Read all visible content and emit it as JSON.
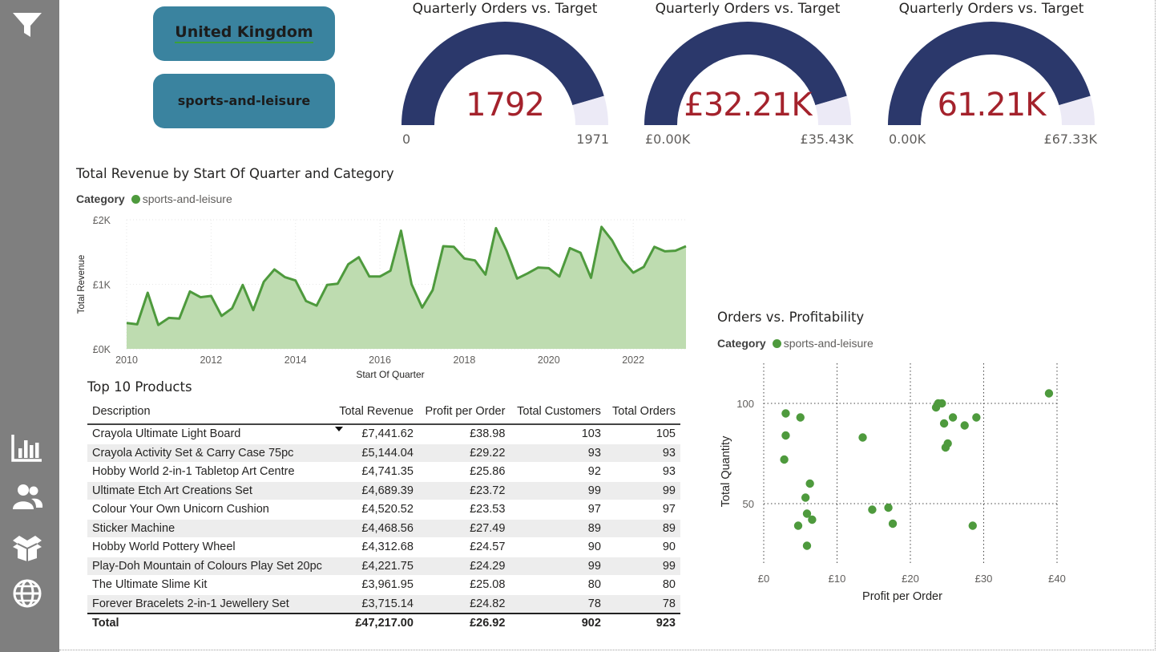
{
  "sidebar": {
    "icons": [
      "filter-icon",
      "bar-chart-icon",
      "people-icon",
      "box-icon",
      "globe-icon"
    ]
  },
  "slicers": {
    "country": "United Kingdom",
    "category": "sports-and-leisure"
  },
  "gauges": [
    {
      "title": "Quarterly Orders vs. Target",
      "value": "1792",
      "min": "0",
      "max": "1971",
      "fraction": 0.909
    },
    {
      "title": "Quarterly Orders vs. Target",
      "value": "£32.21K",
      "min": "£0.00K",
      "max": "£35.43K",
      "fraction": 0.909
    },
    {
      "title": "Quarterly Orders vs. Target",
      "value": "61.21K",
      "min": "0.00K",
      "max": "£67.33K",
      "fraction": 0.909
    }
  ],
  "colors": {
    "gauge_fill": "#2b386b",
    "gauge_track": "#eceaf6",
    "gauge_value": "#a4222c",
    "series": "#4e9a3d",
    "area_fill": "#bedcb0",
    "slicer": "#3a839f",
    "sidebar": "#7f7f7f"
  },
  "area_chart": {
    "title": "Total Revenue by Start Of Quarter and Category",
    "legend_title": "Category",
    "legend_item": "sports-and-leisure",
    "chart_data": {
      "type": "area",
      "xlabel": "Start Of Quarter",
      "ylabel": "Total Revenue",
      "y_ticks": [
        "£0K",
        "£1K",
        "£2K"
      ],
      "x_ticks": [
        "2010",
        "2012",
        "2014",
        "2016",
        "2018",
        "2020",
        "2022"
      ],
      "ylim": [
        0,
        2000
      ],
      "xlim": [
        2010,
        2023.25
      ],
      "x": [
        2010.0,
        2010.25,
        2010.5,
        2010.75,
        2011.0,
        2011.25,
        2011.5,
        2011.75,
        2012.0,
        2012.25,
        2012.5,
        2012.75,
        2013.0,
        2013.25,
        2013.5,
        2013.75,
        2014.0,
        2014.25,
        2014.5,
        2014.75,
        2015.0,
        2015.25,
        2015.5,
        2015.75,
        2016.0,
        2016.25,
        2016.5,
        2016.75,
        2017.0,
        2017.25,
        2017.5,
        2017.75,
        2018.0,
        2018.25,
        2018.5,
        2018.75,
        2019.0,
        2019.25,
        2019.5,
        2019.75,
        2020.0,
        2020.25,
        2020.5,
        2020.75,
        2021.0,
        2021.25,
        2021.5,
        2021.75,
        2022.0,
        2022.25,
        2022.5,
        2022.75,
        2023.0,
        2023.25
      ],
      "series": [
        {
          "name": "sports-and-leisure",
          "values": [
            400,
            380,
            870,
            370,
            480,
            470,
            890,
            800,
            820,
            510,
            630,
            990,
            600,
            1040,
            1230,
            1110,
            1060,
            740,
            670,
            990,
            1010,
            1310,
            1420,
            1120,
            1120,
            1210,
            1830,
            1000,
            640,
            910,
            1590,
            1580,
            1400,
            1370,
            1150,
            1870,
            1520,
            1090,
            1170,
            1260,
            1250,
            1120,
            1560,
            1490,
            1100,
            1890,
            1680,
            1370,
            1180,
            1270,
            1580,
            1510,
            1520,
            1590
          ]
        }
      ]
    }
  },
  "table": {
    "title": "Top 10 Products",
    "headers": [
      "Description",
      "Total Revenue",
      "Profit per Order",
      "Total Customers",
      "Total Orders"
    ],
    "rows": [
      [
        "Crayola Ultimate Light Board",
        "£7,441.62",
        "£38.98",
        "103",
        "105"
      ],
      [
        "Crayola Activity Set & Carry Case 75pc",
        "£5,144.04",
        "£29.22",
        "93",
        "93"
      ],
      [
        "Hobby World 2-in-1 Tabletop Art Centre",
        "£4,741.35",
        "£25.86",
        "92",
        "93"
      ],
      [
        "Ultimate Etch Art Creations Set",
        "£4,689.39",
        "£23.72",
        "99",
        "99"
      ],
      [
        "Colour Your Own Unicorn Cushion",
        "£4,520.52",
        "£23.53",
        "97",
        "97"
      ],
      [
        "Sticker Machine",
        "£4,468.56",
        "£27.49",
        "89",
        "89"
      ],
      [
        "Hobby World Pottery Wheel",
        "£4,312.68",
        "£24.57",
        "90",
        "90"
      ],
      [
        "Play-Doh Mountain of Colours Play Set 20pc",
        "£4,221.75",
        "£24.29",
        "99",
        "99"
      ],
      [
        "The Ultimate Slime Kit",
        "£3,961.95",
        "£25.08",
        "80",
        "80"
      ],
      [
        "Forever Bracelets 2-in-1 Jewellery Set",
        "£3,715.14",
        "£24.82",
        "78",
        "78"
      ]
    ],
    "total": [
      "Total",
      "£47,217.00",
      "£26.92",
      "902",
      "923"
    ]
  },
  "scatter_chart": {
    "title": "Orders vs. Profitability",
    "legend_title": "Category",
    "legend_item": "sports-and-leisure",
    "chart_data": {
      "type": "scatter",
      "xlabel": "Profit per Order",
      "ylabel": "Total Quantity",
      "x_ticks": [
        "£0",
        "£10",
        "£20",
        "£30",
        "£40"
      ],
      "y_ticks": [
        "50",
        "100"
      ],
      "xlim": [
        0,
        40
      ],
      "ylim": [
        20,
        120
      ],
      "points": [
        [
          3.0,
          95
        ],
        [
          5.0,
          93
        ],
        [
          3.0,
          84
        ],
        [
          2.8,
          72
        ],
        [
          6.3,
          60
        ],
        [
          5.7,
          53
        ],
        [
          5.9,
          45
        ],
        [
          6.6,
          42
        ],
        [
          4.7,
          39
        ],
        [
          5.9,
          29
        ],
        [
          13.5,
          83
        ],
        [
          14.8,
          47
        ],
        [
          17.0,
          48
        ],
        [
          17.6,
          40
        ],
        [
          23.5,
          98
        ],
        [
          23.8,
          100
        ],
        [
          24.3,
          100
        ],
        [
          24.6,
          90
        ],
        [
          25.8,
          93
        ],
        [
          25.1,
          80
        ],
        [
          24.8,
          78
        ],
        [
          27.4,
          89
        ],
        [
          29.0,
          93
        ],
        [
          28.5,
          39
        ],
        [
          38.9,
          105
        ]
      ]
    }
  }
}
